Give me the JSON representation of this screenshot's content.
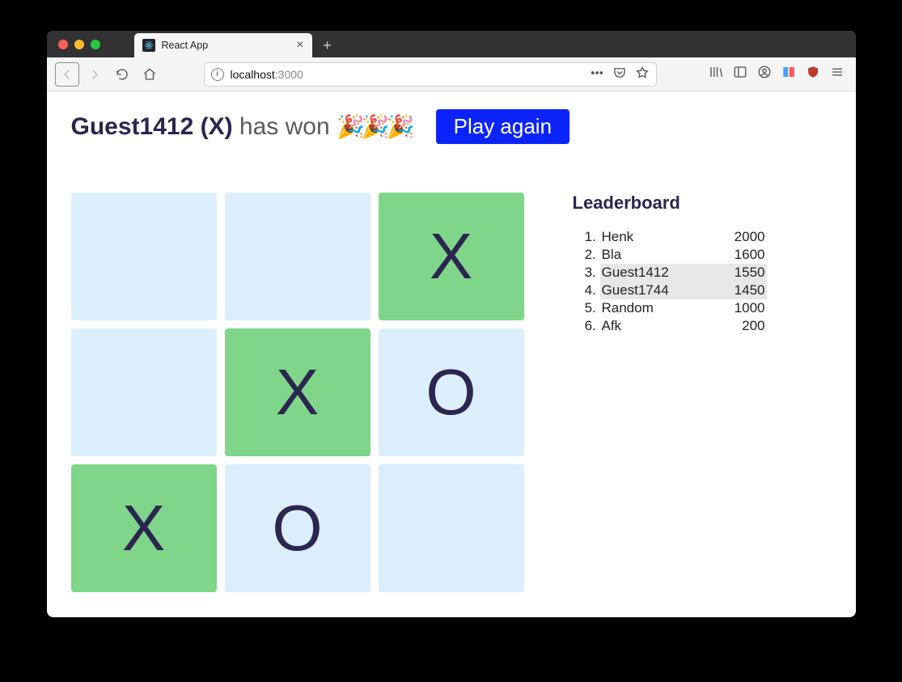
{
  "browser": {
    "tab_title": "React App",
    "url_host": "localhost",
    "url_port": ":3000"
  },
  "status": {
    "winner_label": "Guest1412 (X)",
    "suffix_text": " has won ",
    "confetti": "🎉🎉🎉",
    "play_again_label": "Play again"
  },
  "board": {
    "cells": [
      {
        "mark": "",
        "win": false
      },
      {
        "mark": "",
        "win": false
      },
      {
        "mark": "X",
        "win": true
      },
      {
        "mark": "",
        "win": false
      },
      {
        "mark": "X",
        "win": true
      },
      {
        "mark": "O",
        "win": false
      },
      {
        "mark": "X",
        "win": true
      },
      {
        "mark": "O",
        "win": false
      },
      {
        "mark": "",
        "win": false
      }
    ]
  },
  "leaderboard": {
    "title": "Leaderboard",
    "entries": [
      {
        "name": "Henk",
        "score": "2000",
        "highlight": false
      },
      {
        "name": "Bla",
        "score": "1600",
        "highlight": false
      },
      {
        "name": "Guest1412",
        "score": "1550",
        "highlight": true
      },
      {
        "name": "Guest1744",
        "score": "1450",
        "highlight": true
      },
      {
        "name": "Random",
        "score": "1000",
        "highlight": false
      },
      {
        "name": "Afk",
        "score": "200",
        "highlight": false
      }
    ]
  },
  "colors": {
    "accent": "#0b24fb",
    "cell_bg": "#dbeefc",
    "cell_win": "#7fd68a",
    "text_dark": "#2b2550"
  }
}
